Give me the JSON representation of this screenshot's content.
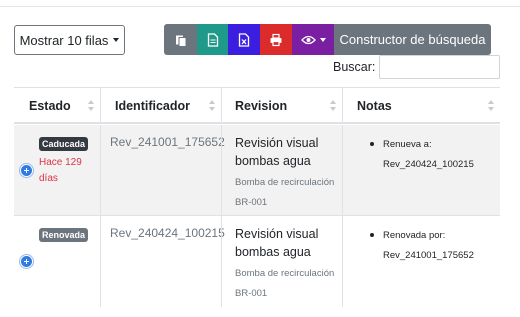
{
  "toolbar": {
    "length_label": "Mostrar 10 filas",
    "buttons": [
      "copy-icon",
      "csv-icon",
      "excel-icon",
      "print-icon",
      "eye-icon"
    ],
    "builder_label": "Constructor de búsqueda",
    "colors": {
      "copy": "#6c757d",
      "csv": "#1f9a8a",
      "excel": "#3b1ee0",
      "print": "#dc2b2b",
      "columns": "#7b1fa2"
    }
  },
  "search": {
    "label": "Buscar:",
    "value": ""
  },
  "table": {
    "columns": [
      "Estado",
      "Identificador",
      "Revision",
      "Notas"
    ],
    "rows": [
      {
        "status": "Caducada",
        "status_note": "Hace 129 días",
        "id": "Rev_241001_175652",
        "title": "Revisión visual bombas agua",
        "subtitle": "Bomba de recirculación BR-001",
        "note_label": "Renueva a:",
        "note_ref": "Rev_240424_100215"
      },
      {
        "status": "Renovada",
        "status_note": "",
        "id": "Rev_240424_100215",
        "title": "Revisión visual bombas agua",
        "subtitle": "Bomba de recirculación BR-001",
        "note_label": "Renovada por:",
        "note_ref": "Rev_241001_175652"
      }
    ]
  }
}
